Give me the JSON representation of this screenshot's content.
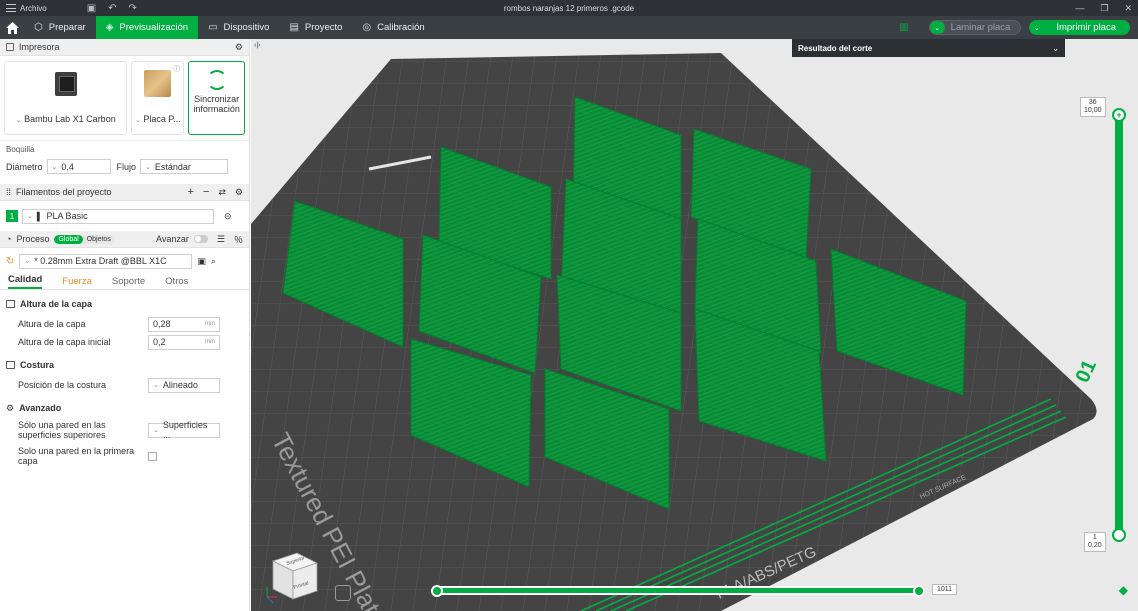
{
  "titlebar": {
    "menu_label": "Archivo",
    "title": "rombos naranjas 12 primeros .gcode"
  },
  "nav": {
    "tabs": [
      {
        "label": "Preparar",
        "icon": "cube-icon"
      },
      {
        "label": "Previsualización",
        "icon": "preview-icon"
      },
      {
        "label": "Dispositivo",
        "icon": "monitor-icon"
      },
      {
        "label": "Proyecto",
        "icon": "project-icon"
      },
      {
        "label": "Calibración",
        "icon": "calibration-icon"
      }
    ],
    "slice_label": "Laminar placa",
    "print_label": "Imprimir placa"
  },
  "printer": {
    "header": "Impresora",
    "printer_name": "Bambu Lab X1 Carbon",
    "plate_name": "Placa P...",
    "sync_label_line1": "Sincronizar",
    "sync_label_line2": "información",
    "nozzle_title": "Boquilla",
    "diameter_label": "Diámetro",
    "diameter_value": "0,4",
    "flow_label": "Flujo",
    "flow_value": "Estándar"
  },
  "filaments": {
    "header": "Filamentos del proyecto",
    "items": [
      {
        "index": "1",
        "name": "PLA Basic",
        "color": "#00ae42"
      }
    ]
  },
  "process": {
    "header": "Proceso",
    "toggle_global": "Global",
    "toggle_objects": "Objetos",
    "advanced_label": "Avanzar",
    "profile": "* 0.28mm Extra Draft @BBL X1C",
    "tabs": [
      "Calidad",
      "Fuerza",
      "Soporte",
      "Otros"
    ],
    "groups": {
      "layer": {
        "title": "Altura de la capa",
        "layer_height_label": "Altura de la capa",
        "layer_height_value": "0,28",
        "initial_layer_label": "Altura de la capa inicial",
        "initial_layer_value": "0,2",
        "unit": "mm"
      },
      "seam": {
        "title": "Costura",
        "seam_pos_label": "Posición de la costura",
        "seam_pos_value": "Alineado"
      },
      "advanced": {
        "title": "Avanzado",
        "one_wall_top_label": "Sólo una pared en las superficies superiores",
        "one_wall_top_value": "Superficies ...",
        "one_wall_first_label": "Solo una pared en la primera capa"
      }
    }
  },
  "viewport": {
    "result_label": "Resultado del corte",
    "plate_texture_label": "Textured PEI Plate",
    "plate_materials_label": "PLA/ABS/PETG",
    "plate_hot_label": "HOT SURFACE",
    "plate_number": "01",
    "top_layer": "36",
    "top_height": "10,00",
    "bottom_layer": "1",
    "bottom_height": "0,20",
    "move_value": "1011",
    "layer_top_fraction": 1.0,
    "move_fraction": 1.0,
    "cube_top": "Superior",
    "cube_front": "Frontal",
    "accent": "#00ae42"
  }
}
